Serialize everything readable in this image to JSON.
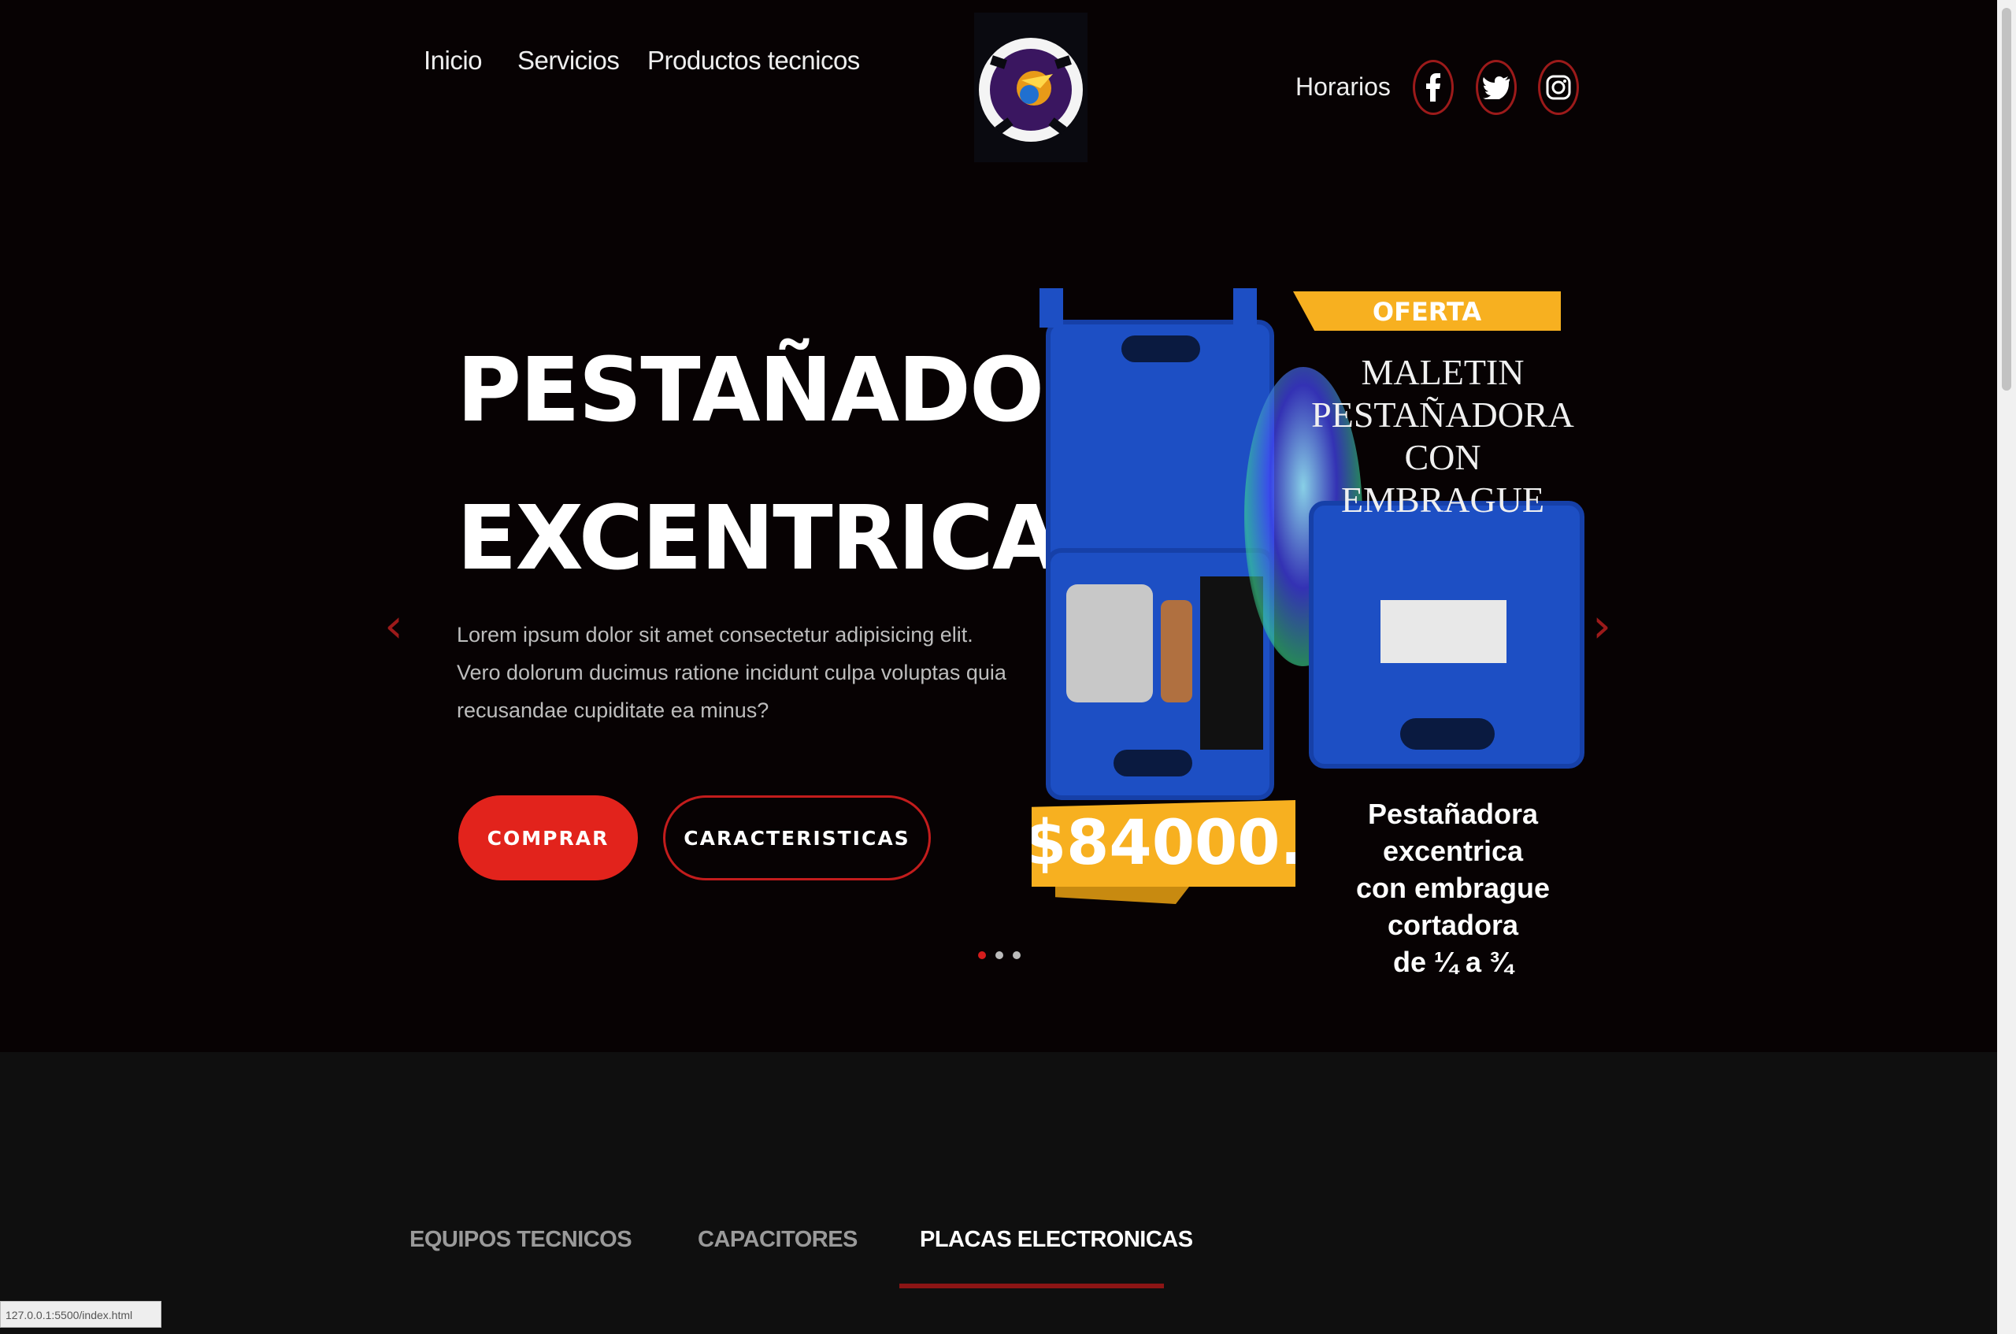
{
  "nav": {
    "left": [
      "Inicio",
      "Servicios",
      "Productos tecnicos"
    ],
    "right_label": "Horarios",
    "socials": [
      "facebook-icon",
      "twitter-icon",
      "instagram-icon"
    ]
  },
  "hero": {
    "title_line1": "PESTAÑADORA",
    "title_line2": "EXCENTRICA.",
    "description": "Lorem ipsum dolor sit amet consectetur adipisicing elit. Vero dolorum ducimus ratione incidunt culpa voluptas quia recusandae cupiditate ea minus?",
    "buy_label": "COMPRAR",
    "features_label": "CARACTERISTICAS",
    "prev_arrow": "‹",
    "next_arrow": "›",
    "slides": 3,
    "active_slide": 1
  },
  "promo": {
    "badge": "OFERTA",
    "title_line1": "MALETIN",
    "title_line2": "PESTAÑADORA",
    "title_line3": "CON EMBRAGUE",
    "price": "$84000.",
    "desc_line1": "Pestañadora excentrica",
    "desc_line2": "con embrague cortadora",
    "desc_line3": "de ¼ a ¾"
  },
  "tabs": [
    "EQUIPOS TECNICOS",
    "CAPACITORES",
    "PLACAS ELECTRONICAS"
  ],
  "active_tab": "PLACAS ELECTRONICAS",
  "status_bar": "127.0.0.1:5500/index.html",
  "colors": {
    "accent": "#e2231c",
    "offer": "#f7b020",
    "background": "#070203"
  }
}
